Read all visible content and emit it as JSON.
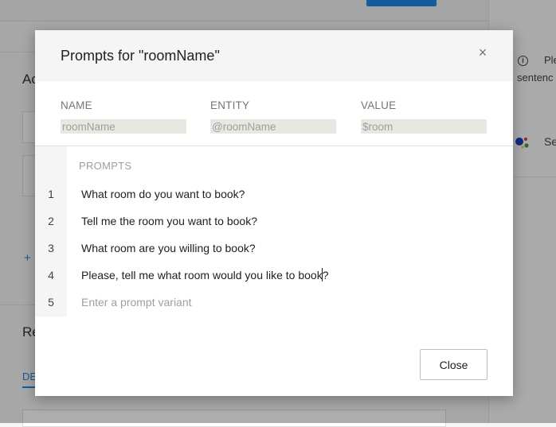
{
  "background": {
    "actions_heading_partial": "Ac",
    "add_icon": "plus-icon",
    "responses_heading_partial": "Re",
    "tab_partial": "DE",
    "right_panel": {
      "info_text_partial": "Ple",
      "info_text_line2_partial": "sentenc",
      "google_assistant_icon": "google-assistant-icon",
      "item_partial": "Se"
    }
  },
  "dialog": {
    "title": "Prompts for \"roomName\"",
    "close_icon": "close-icon",
    "close_glyph": "×",
    "parameter": {
      "name_label": "NAME",
      "name_value": "roomName",
      "entity_label": "ENTITY",
      "entity_value": "@roomName",
      "value_label": "VALUE",
      "value_value": "$room"
    },
    "prompts_label": "PROMPTS",
    "prompts": [
      {
        "number": "1",
        "text": "What room do you want to book?"
      },
      {
        "number": "2",
        "text": "Tell me the room you want to book?"
      },
      {
        "number": "3",
        "text": "What room are you willing to book?"
      },
      {
        "number": "4",
        "text": "Please, tell me what room would you like to book?"
      }
    ],
    "new_prompt": {
      "number": "5",
      "placeholder": "Enter a prompt variant"
    },
    "close_button_label": "Close"
  },
  "colors": {
    "accent": "#1e88e5",
    "overlay": "rgba(0,0,0,0.32)",
    "readonly_input_bg": "#e8e8e2"
  }
}
